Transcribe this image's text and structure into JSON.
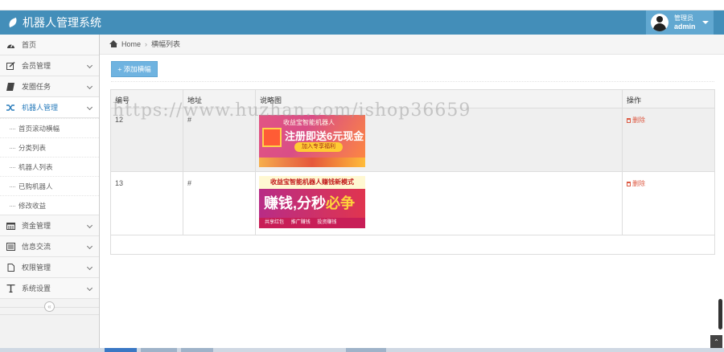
{
  "app": {
    "title": "机器人管理系统"
  },
  "user": {
    "role": "管理员",
    "name": "admin"
  },
  "sidebar": {
    "items": [
      {
        "label": "首页",
        "icon": "dashboard-icon"
      },
      {
        "label": "会员管理",
        "icon": "edit-icon"
      },
      {
        "label": "发圈任务",
        "icon": "book-icon"
      },
      {
        "label": "机器人管理",
        "icon": "shuffle-icon"
      },
      {
        "label": "资金管理",
        "icon": "calendar-icon"
      },
      {
        "label": "信息交流",
        "icon": "list-alt-icon"
      },
      {
        "label": "权限管理",
        "icon": "file-icon"
      },
      {
        "label": "系统设置",
        "icon": "text-icon"
      }
    ],
    "subitems": [
      "首页滚动横幅",
      "分类列表",
      "机器人列表",
      "已购机器人",
      "修改收益"
    ],
    "collapse_glyph": "«"
  },
  "breadcrumb": {
    "home": "Home",
    "current": "横幅列表"
  },
  "toolbar": {
    "add_label": "+ 添加横幅"
  },
  "table": {
    "headers": [
      "编号",
      "地址",
      "说略图",
      "操作"
    ],
    "rows": [
      {
        "id": "12",
        "address": "#",
        "action": "删除"
      },
      {
        "id": "13",
        "address": "#",
        "action": "删除"
      }
    ]
  },
  "banners": [
    {
      "top": "收益宝智能机器人",
      "main": "注册即送6元现金",
      "button": "加入专享福利"
    },
    {
      "slogan": "收益宝智能机器人赚钱新模式",
      "word_a": "赚钱,分秒",
      "word_b": "必争",
      "tags": [
        "共享红包",
        "推广赚钱",
        "投资赚钱"
      ]
    }
  ],
  "watermark": "https://www.huzhan.com/ishop36659",
  "colors": {
    "navbar": "#438eb9",
    "userbox": "#62a8d1",
    "active": "#2b7dbc",
    "delete": "#dd5a43",
    "button": "#6fb3e0"
  },
  "totop_glyph": "⌃"
}
